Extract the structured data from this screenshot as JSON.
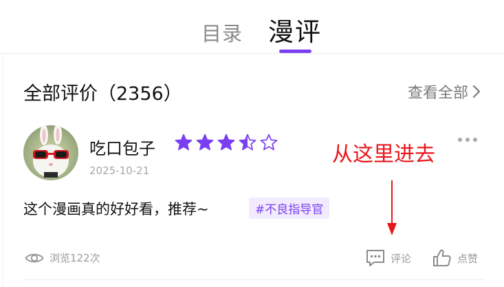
{
  "tabs": [
    {
      "label": "目录",
      "active": false
    },
    {
      "label": "漫评",
      "active": true
    }
  ],
  "accent_color": "#7b3ff2",
  "reviews_header": {
    "title": "全部评价（2356）",
    "see_all": "查看全部"
  },
  "review": {
    "username": "吃口包子",
    "rating": 3.5,
    "rating_max": 5,
    "date": "2025-10-21",
    "text": "这个漫画真的好好看，推荐~",
    "tag": "#不良指导官",
    "views": "浏览122次",
    "comment_label": "评论",
    "like_label": "点赞"
  },
  "annotation": {
    "text": "从这里进去",
    "color": "#e8151b"
  },
  "icons": [
    "chevron-right-icon",
    "star-icon",
    "more-dots-icon",
    "eye-icon",
    "comment-icon",
    "thumbs-up-icon",
    "arrow-down-icon"
  ]
}
